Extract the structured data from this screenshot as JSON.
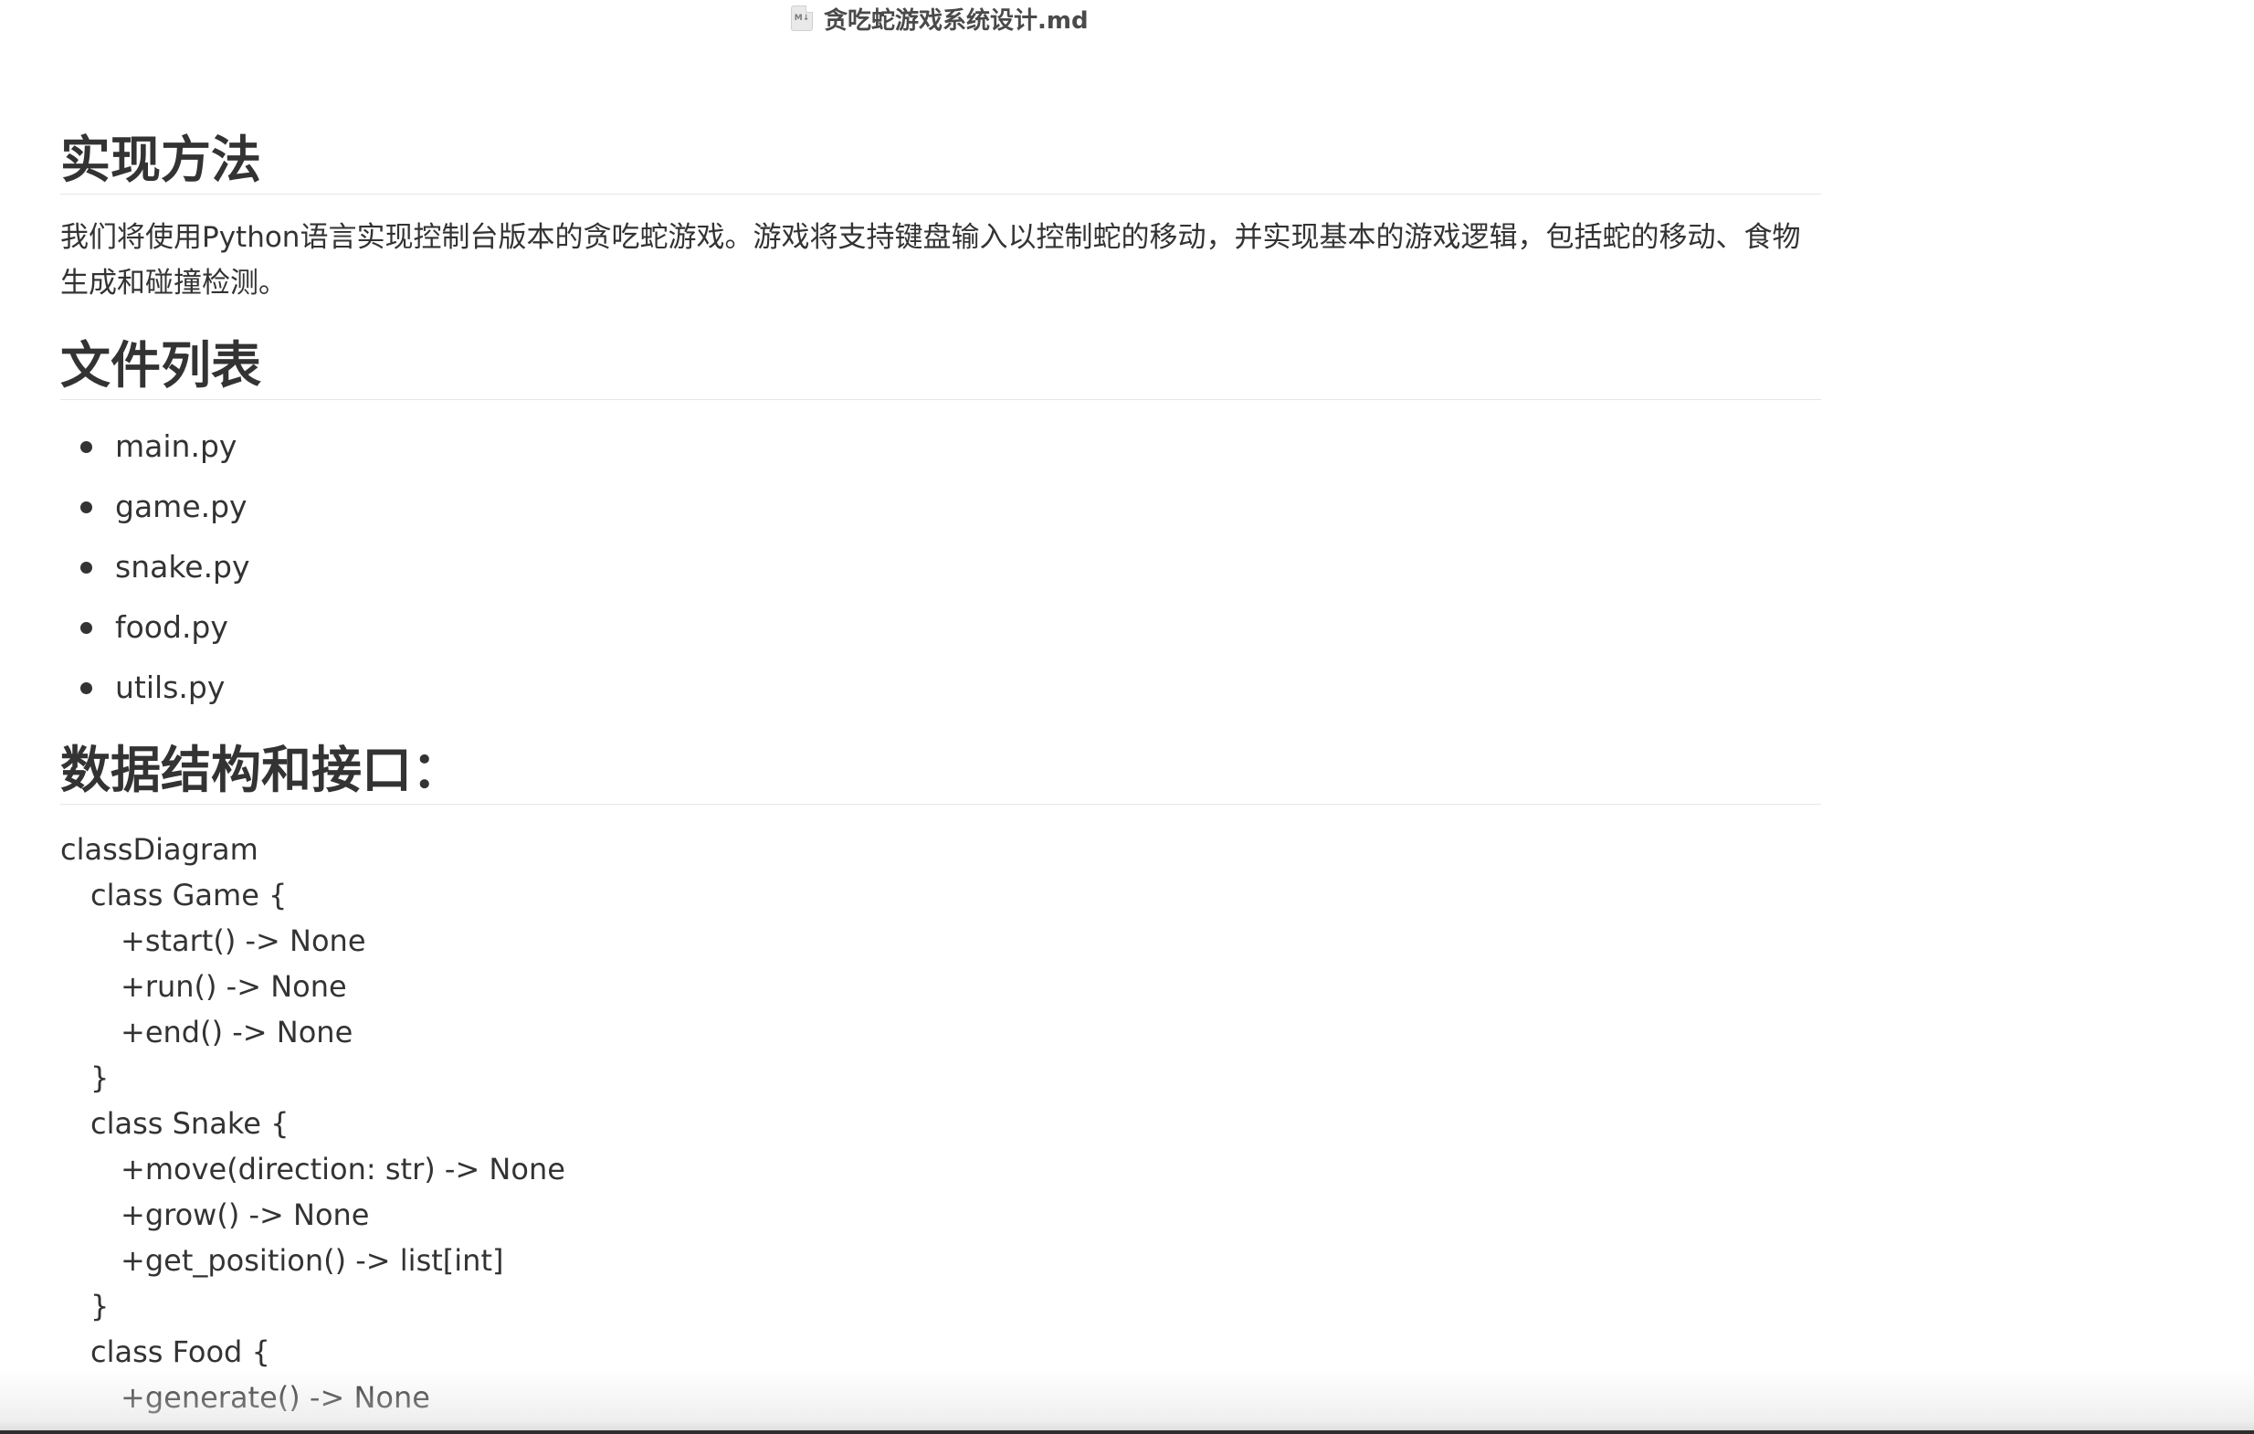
{
  "window": {
    "title": "贪吃蛇游戏系统设计.md",
    "file_icon": "markdown-file-icon",
    "file_icon_text": "M↓"
  },
  "sections": {
    "implementation": {
      "heading": "实现方法",
      "text": "我们将使用Python语言实现控制台版本的贪吃蛇游戏。游戏将支持键盘输入以控制蛇的移动，并实现基本的游戏逻辑，包括蛇的移动、食物生成和碰撞检测。"
    },
    "files": {
      "heading": "文件列表",
      "items": [
        "main.py",
        "game.py",
        "snake.py",
        "food.py",
        "utils.py"
      ]
    },
    "data_structures": {
      "heading": "数据结构和接口：",
      "lines": [
        "classDiagram",
        "class Game {",
        "+start() -> None",
        "+run() -> None",
        "+end() -> None",
        "}",
        "class Snake {",
        "+move(direction: str) -> None",
        "+grow() -> None",
        "+get_position() -> list[int]",
        "}",
        "class Food {",
        "+generate() -> None"
      ]
    }
  }
}
